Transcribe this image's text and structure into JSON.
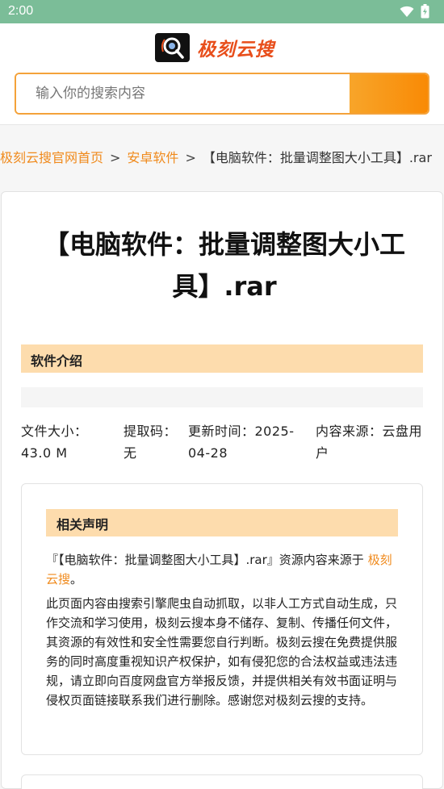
{
  "status_bar": {
    "time": "2:00",
    "icons": [
      "wifi-icon",
      "battery-icon"
    ]
  },
  "header": {
    "logo_text": "极刻云搜",
    "search_placeholder": "输入你的搜索内容"
  },
  "breadcrumb": {
    "items": [
      "极刻云搜官网首页",
      "安卓软件"
    ],
    "separator": ">",
    "current": "【电脑软件：批量调整图大小工具】.rar"
  },
  "article": {
    "title": "【电脑软件：批量调整图大小工具】.rar",
    "section_title": "软件介绍",
    "meta": {
      "size": "文件大小：43.0 M",
      "code": "提取码：无",
      "updated": "更新时间：2025-04-28",
      "source": "内容来源：云盘用户"
    }
  },
  "notice": {
    "title": "相关声明",
    "p1_prefix": "『【电脑软件：批量调整图大小工具】.rar』资源内容来源于",
    "p1_link": "极刻云搜",
    "p1_suffix": "。",
    "p2": "此页面内容由搜索引擎爬虫自动抓取，以非人工方式自动生成，只作交流和学习使用，极刻云搜本身不储存、复制、传播任何文件，其资源的有效性和安全性需要您自行判断。极刻云搜在免费提供服务的同时高度重视知识产权保护，如有侵犯您的合法权益或违法违规，请立即向百度网盘官方举报反馈，并提供相关有效书面证明与侵权页面链接联系我们进行删除。感谢您对极刻云搜的支持。"
  },
  "colors": {
    "status_bar": "#7bbd98",
    "accent": "#f08a1c",
    "section_bg": "#fddcad",
    "search_border": "#f4a23a",
    "logo_text": "#e84e1b"
  }
}
